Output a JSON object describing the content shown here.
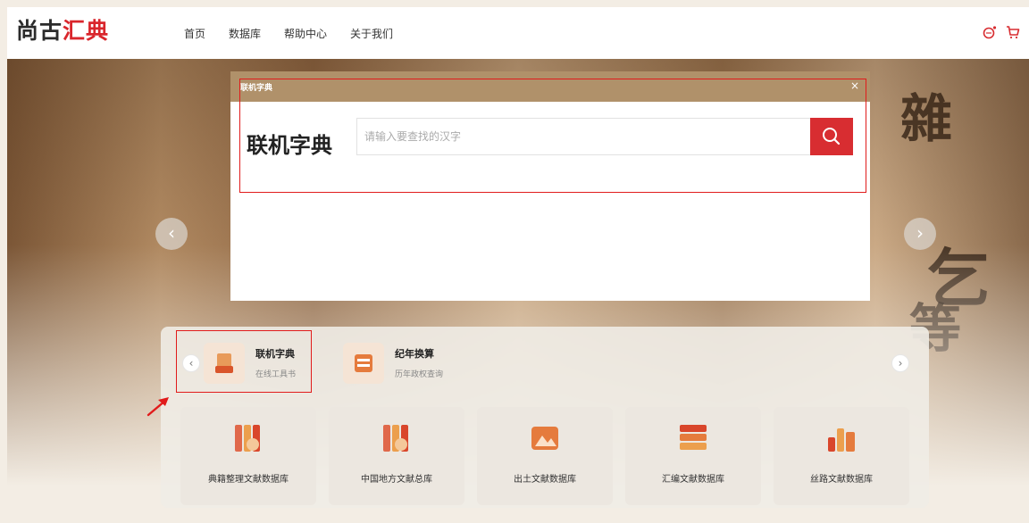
{
  "brand": {
    "logo_part1": "尚古",
    "logo_part2": "汇典"
  },
  "nav": {
    "items": [
      "首页",
      "数据库",
      "帮助中心",
      "关于我们"
    ]
  },
  "header_icons": [
    "message-icon",
    "cart-icon"
  ],
  "hero": {
    "prev_label": "‹",
    "next_label": "›"
  },
  "modal": {
    "header_title": "联机字典",
    "close_label": "×",
    "title": "联机字典",
    "search_placeholder": "请输入要查找的汉字",
    "search_icon": "search-icon"
  },
  "tools": {
    "prev_label": "‹",
    "next_label": "›",
    "items": [
      {
        "name": "联机字典",
        "sub": "在线工具书",
        "icon": "dictionary-icon"
      },
      {
        "name": "纪年换算",
        "sub": "历年政权查询",
        "icon": "calendar-icon"
      }
    ]
  },
  "databases": [
    {
      "label": "典籍整理文献数据库",
      "icon": "books-icon"
    },
    {
      "label": "中国地方文献总库",
      "icon": "books-icon"
    },
    {
      "label": "出土文献数据库",
      "icon": "excavation-icon"
    },
    {
      "label": "汇编文献数据库",
      "icon": "compilation-icon"
    },
    {
      "label": "丝路文献数据库",
      "icon": "silk-road-icon"
    }
  ],
  "colors": {
    "accent": "#d82d31",
    "modal_header": "#b0916a",
    "highlight": "#e11b1b"
  }
}
